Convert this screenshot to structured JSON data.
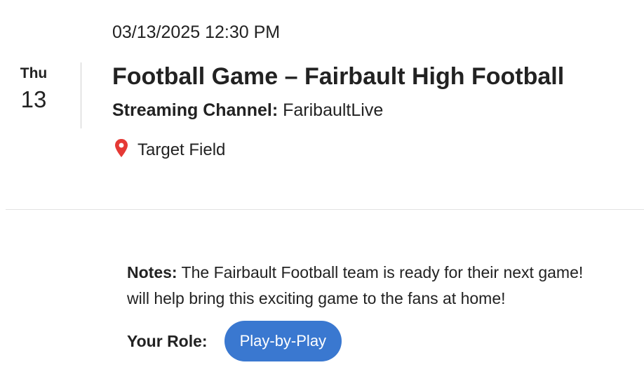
{
  "event": {
    "datetime": "03/13/2025 12:30 PM",
    "day_of_week": "Thu",
    "day_number": "13",
    "title": "Football Game – Fairbault High Football",
    "channel_label": "Streaming Channel:",
    "channel_value": "FaribaultLive",
    "location": "Target Field",
    "location_icon": "map-pin-icon",
    "notes_label": "Notes:",
    "notes_line1": "The Fairbault Football team is ready for their next game!",
    "notes_line2": "will help bring this exciting game to the fans at home!",
    "role_label": "Your Role:",
    "role_value": "Play-by-Play"
  },
  "colors": {
    "accent": "#3a78d0",
    "pin": "#e53935",
    "text": "#222222",
    "divider": "#e3e3e3"
  }
}
